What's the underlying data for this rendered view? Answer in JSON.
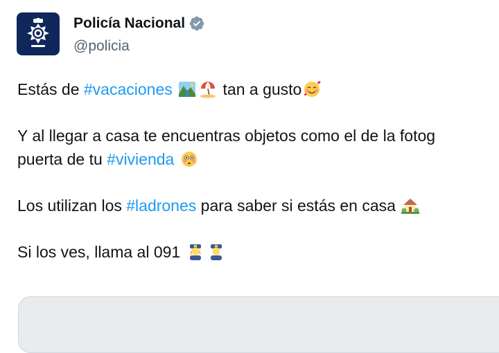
{
  "account": {
    "display_name": "Policía Nacional",
    "handle": "@policia",
    "avatar_icon": "police-badge-logo",
    "verified_icon": "verified-gray-badge",
    "verified_color": "#829aab"
  },
  "tweet": {
    "line1": {
      "pre": "Estás de ",
      "hashtag": "#vacaciones",
      "post": " tan a gusto"
    },
    "line2": {
      "text": "Y al llegar a casa te encuentras objetos como el de la fotog"
    },
    "line3": {
      "pre": "puerta de tu ",
      "hashtag": "#vivienda"
    },
    "line4": {
      "pre": "Los utilizan los ",
      "hashtag": "#ladrones",
      "post": " para saber si estás en casa"
    },
    "line5": {
      "text": "Si los ves, llama al 091"
    }
  },
  "colors": {
    "hashtag": "#1d9bf0",
    "text": "#0f1419",
    "secondary": "#536471",
    "avatar_bg": "#10275b"
  }
}
